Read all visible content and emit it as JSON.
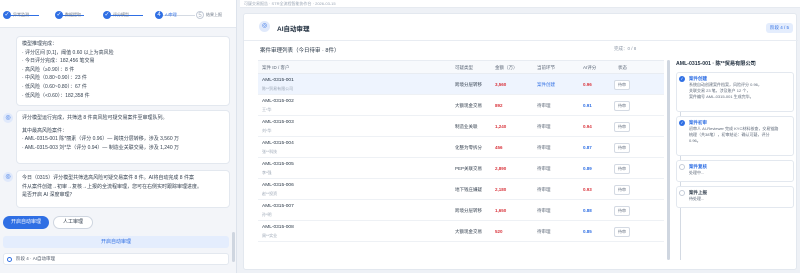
{
  "steps": [
    {
      "label": "异常监测",
      "state": "done"
    },
    {
      "label": "数据提取",
      "state": "done"
    },
    {
      "label": "评分模型",
      "state": "done"
    },
    {
      "label": "AI审理",
      "state": "current"
    },
    {
      "label": "结果上报",
      "state": "todo"
    }
  ],
  "top_bar": "可疑交易报告 · STR全流程智能协作台 · 2026-03-15",
  "chat": {
    "msg1": [
      "模型推理完成：",
      "· 评分区间 [0,1]，阈值 0.60 以上为高风险",
      "· 今日评分完成：182,456 笔交易",
      "· 高风险（≥0.90）：8 件",
      "· 中风险（0.80~0.90）：23 件",
      "· 低风险（0.60~0.80）：67 件",
      "· 低风险（<0.60）：182,358 件"
    ],
    "msg2a": "评分模型运行完成，共筛选 8 件高风险可疑交易案件至审理队列。",
    "msg2b_head": "其中最高风险案件：",
    "msg2b": [
      "· AML-0315-001 陈*丽素（评分 0.96）— 跨境分层转移，涉及 3,560 万",
      "· AML-0315-003 刘*华（评分 0.94）— 制造业关联交易，涉及 1,240 万"
    ],
    "msg3": [
      "今日（0315）评分模型共筛选高风险可疑交易案件 8 件。AI将自动完成 8 件案",
      "件从案件创建→初审→复核→上报的全流程审理，您可在右侧实时跟踪审理进度。",
      "是否开启 AI 深度审理？"
    ],
    "btn_start": "开启自动审理",
    "btn_manual": "人工审理",
    "bar_blue": "开启自动审理",
    "stage": "阶段 4 · AI自动审理"
  },
  "panel": {
    "title": "AI自动审理",
    "badge": "阶段 4 / 5",
    "list_title": "案件审理列表（今日待审 · 8件）",
    "list_count": "完成：0 / 8",
    "headers": [
      "案件 ID / 客户",
      "可疑类型",
      "金额（万）",
      "当前环节",
      "AI评分",
      "状态"
    ],
    "rows": [
      {
        "id": "AML-0315-001",
        "sub": "陈**贸易有限公司",
        "type": "跨境分层转移",
        "amount": "3,560",
        "node": "案件创建",
        "score": "0.96",
        "status": "待审"
      },
      {
        "id": "AML-0315-002",
        "sub": "王*华",
        "type": "大额现金交易",
        "amount": "892",
        "node": "待审理",
        "score": "0.91",
        "status": "待审"
      },
      {
        "id": "AML-0315-003",
        "sub": "刘*华",
        "type": "制造业关联",
        "amount": "1,240",
        "node": "待审理",
        "score": "0.94",
        "status": "待审"
      },
      {
        "id": "AML-0315-004",
        "sub": "张**科技",
        "type": "化整为零拆分",
        "amount": "456",
        "node": "待审理",
        "score": "0.87",
        "status": "待审"
      },
      {
        "id": "AML-0315-005",
        "sub": "李*强",
        "type": "PEP关联交易",
        "amount": "2,890",
        "node": "待审理",
        "score": "0.89",
        "status": "待审"
      },
      {
        "id": "AML-0315-006",
        "sub": "赵**投资",
        "type": "地下钱庄嫌疑",
        "amount": "2,180",
        "node": "待审理",
        "score": "0.93",
        "status": "待审"
      },
      {
        "id": "AML-0315-007",
        "sub": "孙*明",
        "type": "跨境分层转移",
        "amount": "1,650",
        "node": "待审理",
        "score": "0.88",
        "status": "待审"
      },
      {
        "id": "AML-0315-008",
        "sub": "周**实业",
        "type": "大额现金交易",
        "amount": "520",
        "node": "待审理",
        "score": "0.85",
        "status": "待审"
      }
    ],
    "detail": {
      "title": "AML-0315-001 · 陈**贸易有限公司",
      "items": [
        {
          "head": "案件创建",
          "text": [
            "系统自动创建案件档案，风险评分 0.96，",
            "关联交易 23 笔，涉及账户 12 个，",
            "案件编号 AML-0315-001 生成完毕。"
          ],
          "state": "done"
        },
        {
          "head": "案件初审",
          "text": [
            "初审人 AI-Reviewer 完成 KYC材料核查，交易链路",
            "梳理（共38笔），初审结论：确认可疑，评分",
            "0.96。"
          ],
          "state": "done"
        },
        {
          "head": "案件复核",
          "text": [
            "处理中..."
          ],
          "state": "todo"
        },
        {
          "head": "案件上报",
          "text": [
            "待处理..."
          ],
          "state": "todo"
        }
      ]
    }
  }
}
